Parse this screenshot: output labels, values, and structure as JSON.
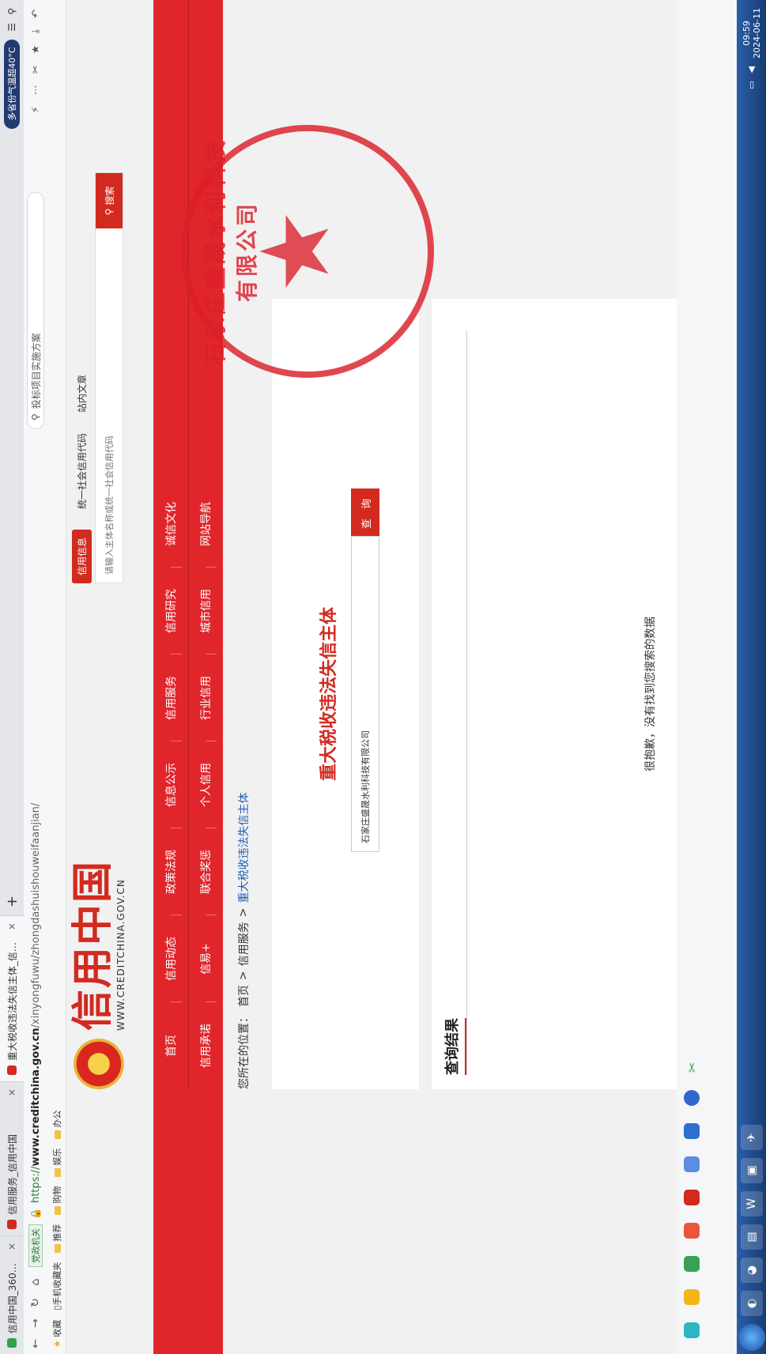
{
  "browser": {
    "tabs": [
      {
        "title": "信用中国_360搜索",
        "close": "×",
        "color": "#2ea34b"
      },
      {
        "title": "信用服务_信用中国",
        "close": "×",
        "color": "#d22a1f"
      },
      {
        "title": "重大税收违法失信主体_信用...",
        "close": "×",
        "color": "#d22a1f"
      }
    ],
    "new_tab": "+",
    "weather": "多省份气温超40°C",
    "url_scheme": "https://",
    "url_host": "www.creditchina.gov.cn",
    "url_path": "/xinyongfuwu/zhongdashuishouweifaanjian/",
    "gov_badge": "党政机关",
    "search_placeholder": "投标项目实施方案",
    "bookmarks": [
      "收藏",
      "手机收藏夹",
      "推荐",
      "购物",
      "娱乐",
      "办公"
    ]
  },
  "site": {
    "logo_cn": "信用中国",
    "logo_en": "WWW.CREDITCHINA.GOV.CN",
    "search_tabs": [
      "信用信息",
      "统一社会信用代码",
      "站内文章"
    ],
    "search_placeholder": "请输入主体名称或统一社会信用代码",
    "search_button": "搜索",
    "menu_row1": [
      "首页",
      "信用动态",
      "政策法规",
      "信息公示",
      "信用服务",
      "信用研究",
      "诚信文化"
    ],
    "menu_row2": [
      "信用承诺",
      "信易+",
      "联合奖惩",
      "个人信用",
      "行业信用",
      "城市信用",
      "网站导航"
    ],
    "breadcrumb": {
      "prefix": "您所在的位置：",
      "items": [
        "首页",
        "信用服务",
        "重大税收违法失信主体"
      ],
      "sep": ">"
    },
    "query": {
      "title": "重大税收违法失信主体",
      "input_value": "石家庄盛晟水利科技有限公司",
      "button": "查 询"
    },
    "results": {
      "heading": "查询结果",
      "empty_message": "很抱歉，没有找到您搜索的数据"
    },
    "seal": {
      "text": "石家庄盛晟水利科技有限公司",
      "star": "★"
    }
  },
  "taskbar": {
    "time": "09:59",
    "date": "2024-06-11"
  }
}
